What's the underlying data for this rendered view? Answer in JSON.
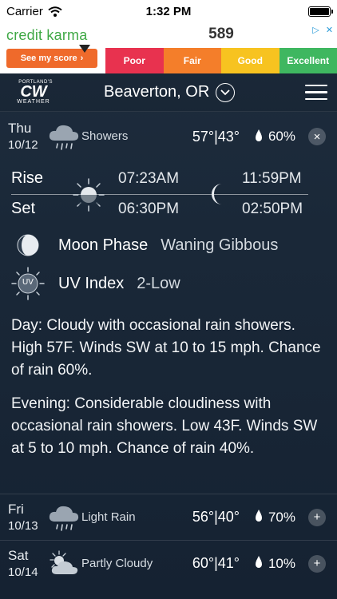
{
  "status_bar": {
    "carrier": "Carrier",
    "time": "1:32 PM"
  },
  "ad": {
    "brand": "credit karma",
    "cta": "See my score",
    "score": "589",
    "bands": [
      {
        "label": "Poor",
        "color": "#e8324f"
      },
      {
        "label": "Fair",
        "color": "#f47e2a"
      },
      {
        "label": "Good",
        "color": "#f7c320"
      },
      {
        "label": "Excellent",
        "color": "#3fb760"
      }
    ]
  },
  "header": {
    "logo_top": "PORTLAND'S",
    "logo_main": "CW",
    "logo_sub": "WEATHER",
    "location": "Beaverton, OR"
  },
  "today": {
    "day": "Thu",
    "date": "10/12",
    "condition": "Showers",
    "temps": "57°|43°",
    "precip": "60%",
    "toggle": "×"
  },
  "sun_moon": {
    "rise_label": "Rise",
    "set_label": "Set",
    "sunrise": "07:23AM",
    "sunset": "06:30PM",
    "moonrise": "11:59PM",
    "moonset": "02:50PM"
  },
  "moon_phase": {
    "label": "Moon Phase",
    "value": "Waning Gibbous"
  },
  "uv": {
    "icon_text": "UV",
    "label": "UV Index",
    "value": "2-Low"
  },
  "day_text": "Day: Cloudy with occasional rain showers. High 57F. Winds SW at 10 to 15 mph. Chance of rain 60%.",
  "evening_text": "Evening: Considerable cloudiness with occasional rain showers. Low 43F. Winds SW at 5 to 10 mph. Chance of rain 40%.",
  "forecast": [
    {
      "day": "Fri",
      "date": "10/13",
      "condition": "Light Rain",
      "temps": "56°|40°",
      "precip": "70%",
      "toggle": "+"
    },
    {
      "day": "Sat",
      "date": "10/14",
      "condition": "Partly Cloudy",
      "temps": "60°|41°",
      "precip": "10%",
      "toggle": "+"
    }
  ],
  "colors": {
    "bg": "#1e2d3e",
    "accent_green": "#3fa845",
    "accent_orange": "#ef6a2b"
  },
  "icons": [
    "wifi-icon",
    "battery-icon",
    "chevron-down-icon",
    "menu-icon",
    "rain-cloud-icon",
    "sun-icon",
    "moon-crescent-icon",
    "moon-gibbous-icon",
    "uv-sun-icon",
    "drop-icon",
    "close-icon",
    "plus-icon",
    "partly-cloudy-icon"
  ]
}
